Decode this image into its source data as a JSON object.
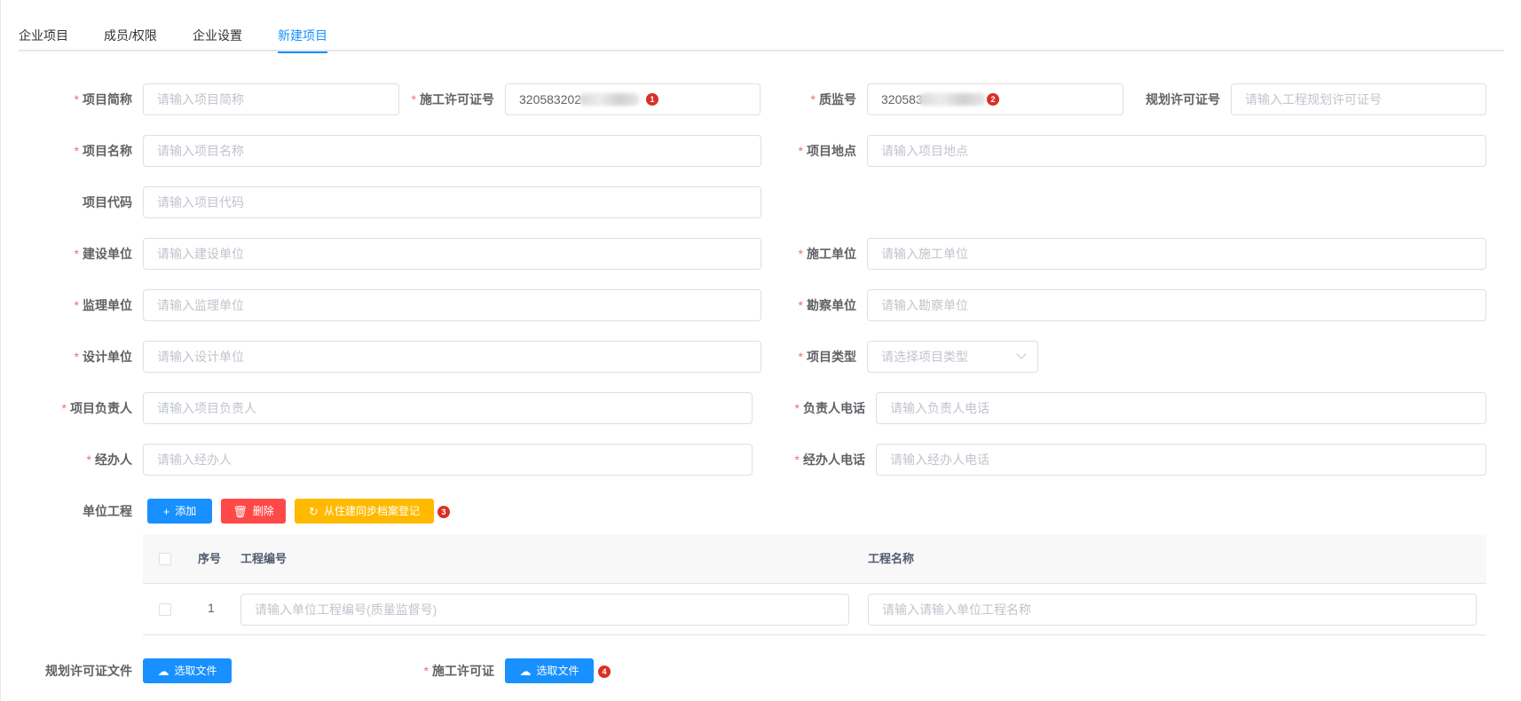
{
  "tabs": [
    {
      "label": "企业项目",
      "active": false
    },
    {
      "label": "成员/权限",
      "active": false
    },
    {
      "label": "企业设置",
      "active": false
    },
    {
      "label": "新建项目",
      "active": true
    }
  ],
  "form": {
    "short_name": {
      "label": "项目简称",
      "required": true,
      "placeholder": "请输入项目简称"
    },
    "permit_no": {
      "label": "施工许可证号",
      "required": true,
      "value": "320583202"
    },
    "quality_no": {
      "label": "质监号",
      "required": true,
      "value": "320583"
    },
    "planning_permit_no": {
      "label": "规划许可证号",
      "required": false,
      "placeholder": "请输入工程规划许可证号"
    },
    "project_name": {
      "label": "项目名称",
      "required": true,
      "placeholder": "请输入项目名称"
    },
    "location": {
      "label": "项目地点",
      "required": true,
      "placeholder": "请输入项目地点"
    },
    "project_code": {
      "label": "项目代码",
      "required": false,
      "placeholder": "请输入项目代码"
    },
    "builder": {
      "label": "建设单位",
      "required": true,
      "placeholder": "请输入建设单位"
    },
    "contractor": {
      "label": "施工单位",
      "required": true,
      "placeholder": "请输入施工单位"
    },
    "supervisor": {
      "label": "监理单位",
      "required": true,
      "placeholder": "请输入监理单位"
    },
    "surveyor": {
      "label": "勘察单位",
      "required": true,
      "placeholder": "请输入勘察单位"
    },
    "designer": {
      "label": "设计单位",
      "required": true,
      "placeholder": "请输入设计单位"
    },
    "project_type": {
      "label": "项目类型",
      "required": true,
      "placeholder": "请选择项目类型"
    },
    "manager": {
      "label": "项目负责人",
      "required": true,
      "placeholder": "请输入项目负责人"
    },
    "manager_phone": {
      "label": "负责人电话",
      "required": true,
      "placeholder": "请输入负责人电话"
    },
    "handler": {
      "label": "经办人",
      "required": true,
      "placeholder": "请输入经办人"
    },
    "handler_phone": {
      "label": "经办人电话",
      "required": true,
      "placeholder": "请输入经办人电话"
    }
  },
  "unit_project": {
    "label": "单位工程",
    "add_label": "添加",
    "delete_label": "删除",
    "sync_label": "从住建同步档案登记",
    "columns": {
      "index": "序号",
      "code": "工程编号",
      "name": "工程名称"
    },
    "rows": [
      {
        "index": "1",
        "code_placeholder": "请输入单位工程编号(质量监督号)",
        "name_placeholder": "请输入请输入单位工程名称"
      }
    ]
  },
  "files": {
    "planning_file": {
      "label": "规划许可证文件",
      "required": false,
      "button": "选取文件"
    },
    "permit_file": {
      "label": "施工许可证",
      "required": true,
      "button": "选取文件"
    }
  },
  "badges": [
    "1",
    "2",
    "3",
    "4"
  ],
  "colors": {
    "primary": "#1890ff",
    "danger": "#ff4949",
    "warning": "#ffba00",
    "required": "#f56c6c",
    "badge": "#d93025"
  },
  "icons": {
    "add": "plus-icon",
    "delete": "trash-icon",
    "sync": "refresh-icon",
    "upload": "cloud-upload-icon",
    "select": "chevron-down-icon"
  }
}
